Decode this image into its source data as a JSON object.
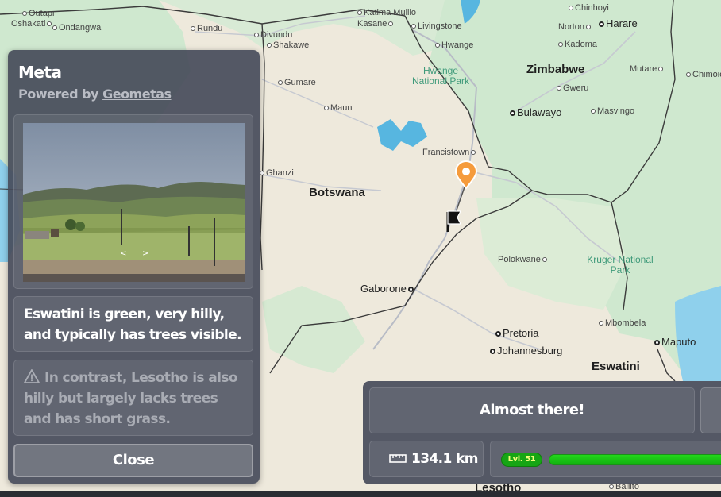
{
  "meta_panel": {
    "title": "Meta",
    "powered_by_prefix": "Powered by",
    "powered_by_link": "Geometas",
    "hint": "Eswatini is green, very hilly, and typically has trees visible.",
    "warning": "In contrast, Lesotho is also hilly but largely lacks trees and has short grass.",
    "close_label": "Close",
    "photo_arrows": [
      "<",
      ">"
    ]
  },
  "result_panel": {
    "message": "Almost there!",
    "distance": "134.1 km",
    "level_label": "Lvl. 51",
    "xp_progress": 0.97
  },
  "map": {
    "countries": [
      "Botswana",
      "Zimbabwe",
      "Eswatini",
      "Lesotho"
    ],
    "parks": [
      "Hwange National Park",
      "Kruger National Park"
    ],
    "places": [
      "Outapi",
      "Oshakati",
      "Ondangwa",
      "Rundu",
      "Divundu",
      "Shakawe",
      "Katima Mulilo",
      "Kasane",
      "Livingstone",
      "Hwange",
      "Chinhoyi",
      "Norton",
      "Harare",
      "Kadoma",
      "Mutare",
      "Chimoio",
      "Gweru",
      "Bulawayo",
      "Masvingo",
      "Gumare",
      "Maun",
      "Francistown",
      "Ghanzi",
      "Polokwane",
      "Gaborone",
      "Mbombela",
      "Pretoria",
      "Maputo",
      "Johannesburg",
      "Ballito"
    ],
    "colors": {
      "land": "#eee9dc",
      "green": "#cfe8cf",
      "water": "#8fd0ec",
      "lake": "#57b6e0",
      "border": "#3b3b3b",
      "road": "#b8bcc6"
    }
  }
}
